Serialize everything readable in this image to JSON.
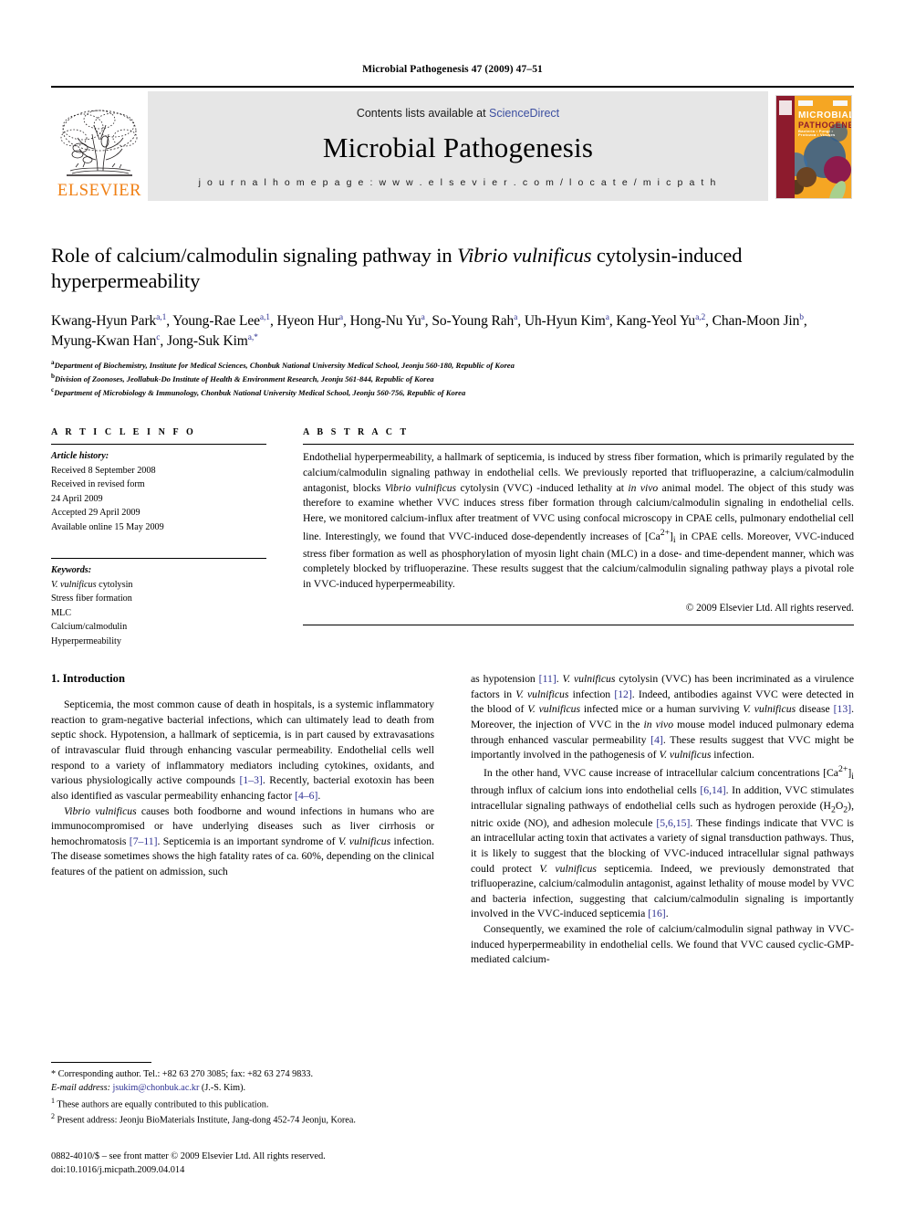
{
  "running_head": "Microbial Pathogenesis 47 (2009) 47–51",
  "masthead": {
    "publisher_name": "ELSEVIER",
    "contents_prefix": "Contents lists available at ",
    "contents_link": "ScienceDirect",
    "journal_title": "Microbial Pathogenesis",
    "homepage": "j o u r n a l   h o m e p a g e :   w w w . e l s e v i e r . c o m / l o c a t e / m i c p a t h",
    "cover": {
      "line1": "MICROBIAL",
      "line2": "PATHOGENESIS",
      "line3": "Bacteria • Fungi • Protozoa • Viruses"
    }
  },
  "article": {
    "title_part1": "Role of calcium/calmodulin signaling pathway in ",
    "title_italic": "Vibrio vulnificus",
    "title_part2": " cytolysin-induced hyperpermeability",
    "authors_line1": "Kwang-Hyun Park",
    "authors": "Kwang-Hyun Park a,1, Young-Rae Lee a,1, Hyeon Hur a, Hong-Nu Yu a, So-Young Rah a, Uh-Hyun Kim a, Kang-Yeol Yu a,2, Chan-Moon Jin b, Myung-Kwan Han c, Jong-Suk Kim a,*",
    "affiliations": [
      "Department of Biochemistry, Institute for Medical Sciences, Chonbuk National University Medical School, Jeonju 560-180, Republic of Korea",
      "Division of Zoonoses, Jeollabuk-Do Institute of Health & Environment Research, Jeonju 561-844, Republic of Korea",
      "Department of Microbiology & Immunology, Chonbuk National University Medical School, Jeonju 560-756, Republic of Korea"
    ],
    "affiliation_marks": [
      "a",
      "b",
      "c"
    ]
  },
  "article_info": {
    "heading": "A R T I C L E   I N F O",
    "history_label": "Article history:",
    "history": [
      "Received 8 September 2008",
      "Received in revised form",
      "24 April 2009",
      "Accepted 29 April 2009",
      "Available online 15 May 2009"
    ],
    "keywords_label": "Keywords:",
    "keywords": [
      "V. vulnificus cytolysin",
      "Stress fiber formation",
      "MLC",
      "Calcium/calmodulin",
      "Hyperpermeability"
    ]
  },
  "abstract": {
    "heading": "A B S T R A C T",
    "copyright": "© 2009 Elsevier Ltd. All rights reserved."
  },
  "introduction": {
    "heading": "1.  Introduction"
  },
  "footnotes": {
    "corresponding": "* Corresponding author. Tel.: +82 63 270 3085; fax: +82 63 274 9833.",
    "email_label": "E-mail address:",
    "email": "jsukim@chonbuk.ac.kr",
    "email_suffix": " (J.-S. Kim).",
    "note1_mark": "1",
    "note1": "These authors are equally contributed to this publication.",
    "note2_mark": "2",
    "note2": "Present address: Jeonju BioMaterials Institute, Jang-dong 452-74 Jeonju, Korea."
  },
  "imprint": {
    "line1": "0882-4010/$ – see front matter © 2009 Elsevier Ltd. All rights reserved.",
    "line2": "doi:10.1016/j.micpath.2009.04.014"
  },
  "colors": {
    "link_blue": "#3b4ea0",
    "reference_blue": "#2e3192",
    "elsevier_orange": "#F07F13",
    "masthead_gray": "#e6e6e6",
    "cover_red": "#8d1b2d",
    "cover_orange": "#F5A623"
  }
}
